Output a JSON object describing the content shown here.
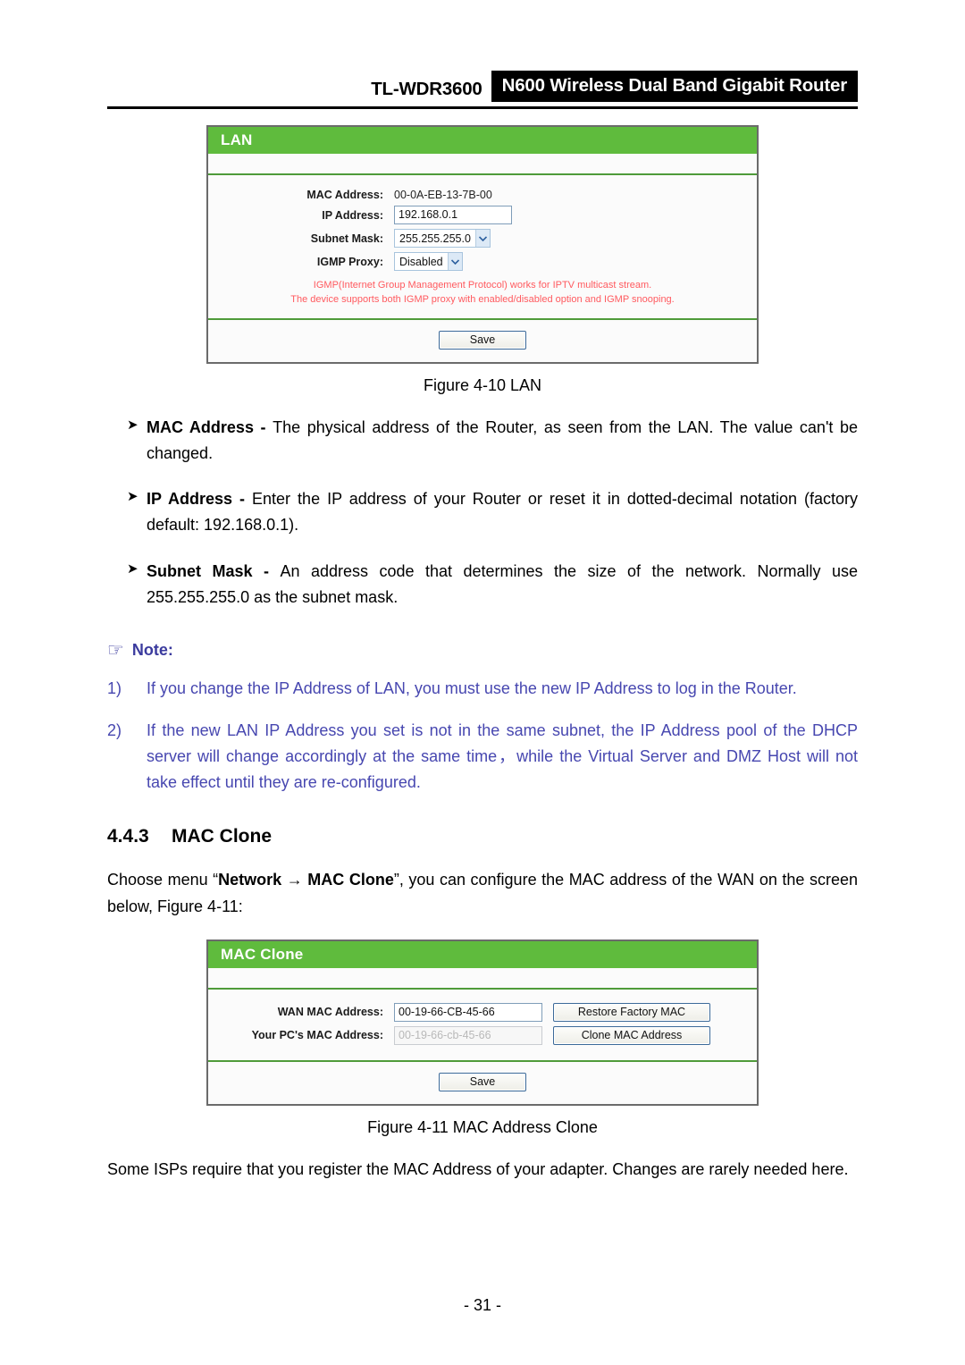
{
  "header": {
    "model": "TL-WDR3600",
    "product": "N600 Wireless Dual Band Gigabit Router"
  },
  "lan_panel": {
    "title": "LAN",
    "rows": [
      {
        "label": "MAC Address:",
        "value": "00-0A-EB-13-7B-00",
        "control": "static"
      },
      {
        "label": "IP Address:",
        "value": "192.168.0.1",
        "control": "text"
      },
      {
        "label": "Subnet Mask:",
        "value": "255.255.255.0",
        "control": "select"
      },
      {
        "label": "IGMP Proxy:",
        "value": "Disabled",
        "control": "select"
      }
    ],
    "hint_line1": "IGMP(Internet Group Management Protocol) works for IPTV multicast stream.",
    "hint_line2": "The device supports both IGMP proxy with enabled/disabled option and IGMP snooping.",
    "save_label": "Save",
    "hint_color": "#ff5a5f",
    "accent_color": "#5fbb3d"
  },
  "figure_lan_caption": "Figure 4-10 LAN",
  "bullets": [
    {
      "term": "MAC Address - ",
      "text": "The physical address of the Router, as seen from the LAN. The value can't be changed."
    },
    {
      "term": "IP Address - ",
      "text": "Enter the IP address of your Router or reset it in dotted-decimal notation (factory default: 192.168.0.1)."
    },
    {
      "term": "Subnet Mask - ",
      "text": "An address code that determines the size of the network. Normally use 255.255.255.0 as the subnet mask."
    }
  ],
  "note": {
    "label": "Note:",
    "color": "#3b3b9e",
    "items": [
      {
        "number": "1)",
        "text": "If you change the IP Address of LAN, you must use the new IP Address to log in the Router."
      },
      {
        "number": "2)",
        "text": "If the new LAN IP Address you set is not in the same subnet, the IP Address pool of the DHCP server will change accordingly at the same time，while the Virtual Server and DMZ Host will not take effect until they are re-configured."
      }
    ]
  },
  "section": {
    "number": "4.4.3",
    "title": "MAC Clone",
    "intro_pre": "Choose menu “",
    "intro_menu1": "Network",
    "intro_arrow": " → ",
    "intro_menu2": "MAC Clone",
    "intro_post": "”, you can configure the MAC address of the WAN on the screen below, Figure 4-11:"
  },
  "clone_panel": {
    "title": "MAC Clone",
    "rows": [
      {
        "label": "WAN MAC Address:",
        "value": "00-19-66-CB-45-66",
        "button": "Restore Factory MAC",
        "disabled": false
      },
      {
        "label": "Your PC's MAC Address:",
        "value": "00-19-66-cb-45-66",
        "button": "Clone MAC Address",
        "disabled": true
      }
    ],
    "save_label": "Save"
  },
  "figure_clone_caption": "Figure 4-11 MAC Address Clone",
  "closing_para": "Some ISPs require that you register the MAC Address of your adapter. Changes are rarely needed here.",
  "page_number": "- 31 -"
}
